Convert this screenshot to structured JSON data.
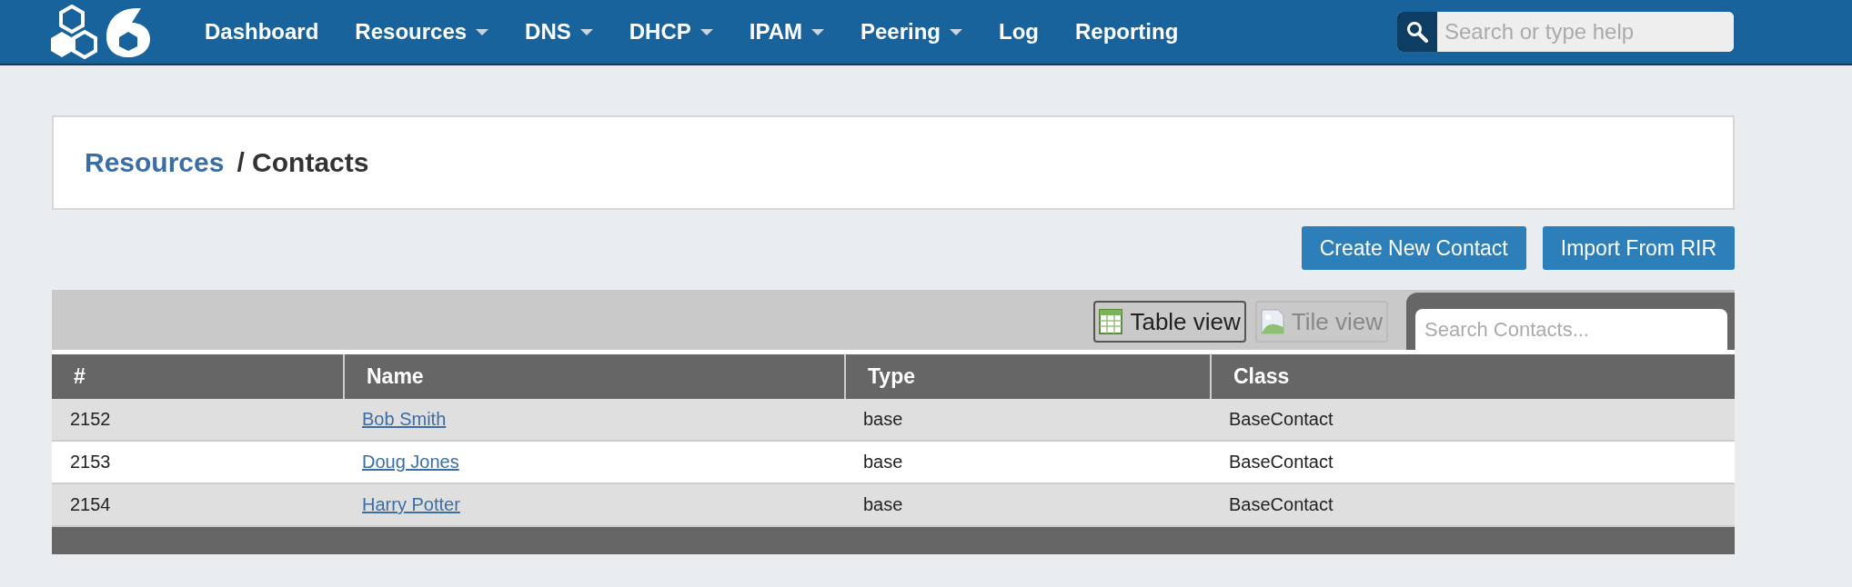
{
  "nav": {
    "items": [
      {
        "label": "Dashboard",
        "dropdown": false
      },
      {
        "label": "Resources",
        "dropdown": true
      },
      {
        "label": "DNS",
        "dropdown": true
      },
      {
        "label": "DHCP",
        "dropdown": true
      },
      {
        "label": "IPAM",
        "dropdown": true
      },
      {
        "label": "Peering",
        "dropdown": true
      },
      {
        "label": "Log",
        "dropdown": false
      },
      {
        "label": "Reporting",
        "dropdown": false
      }
    ],
    "search": {
      "placeholder": "Search or type help"
    }
  },
  "breadcrumb": {
    "parent": "Resources",
    "current": "/ Contacts"
  },
  "actions": [
    "Create New Contact",
    "Import From RIR"
  ],
  "views": [
    {
      "label": "Table view",
      "kind": "table",
      "selected": true
    },
    {
      "label": "Tile view",
      "kind": "tile",
      "selected": false
    }
  ],
  "table_search": {
    "placeholder": "Search Contacts..."
  },
  "table": {
    "columns": [
      "#",
      "Name",
      "Type",
      "Class"
    ],
    "rows": [
      [
        "2152",
        "Bob Smith",
        "base",
        "BaseContact"
      ],
      [
        "2153",
        "Doug Jones",
        "base",
        "BaseContact"
      ],
      [
        "2154",
        "Harry Potter",
        "base",
        "BaseContact"
      ]
    ]
  }
}
